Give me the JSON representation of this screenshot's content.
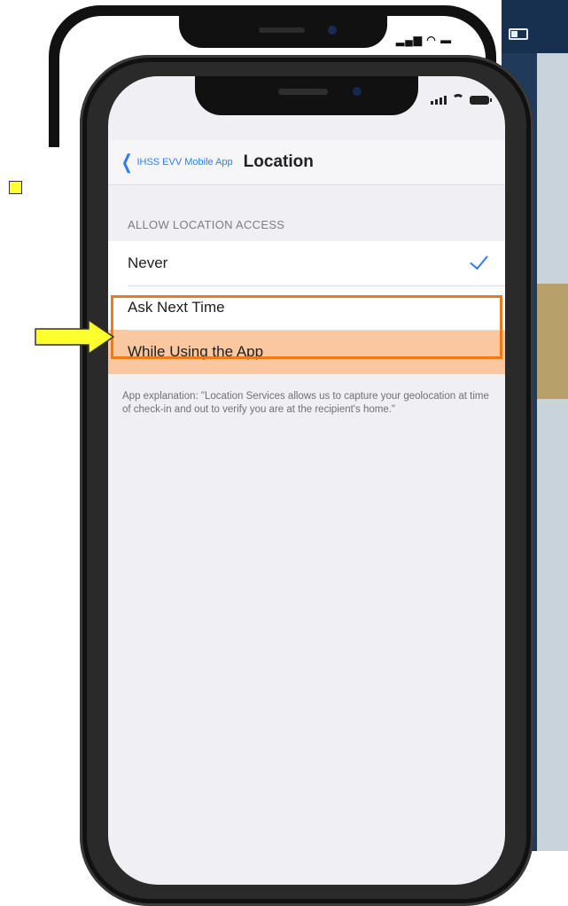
{
  "nav": {
    "back_label": "IHSS EVV Mobile App",
    "title": "Location"
  },
  "section_header": "ALLOW LOCATION ACCESS",
  "options": [
    {
      "label": "Never",
      "checked": true
    },
    {
      "label": "Ask Next Time",
      "checked": false
    },
    {
      "label": "While Using the App",
      "checked": false,
      "highlighted": true
    }
  ],
  "explanation": "App explanation: \"Location Services allows us to capture your geolocation at time of check-in and out to verify you are at the recipient's home.\"",
  "icons": {
    "back": "chevron-left-icon",
    "check": "checkmark-icon",
    "signal": "cellular-signal-icon",
    "wifi": "wifi-icon",
    "battery": "battery-icon",
    "arrow": "right-arrow-icon"
  },
  "colors": {
    "accent": "#2f7df6",
    "highlight_fill": "#f9c8a1",
    "highlight_border": "#f07a18",
    "arrow_fill": "#ffff2e"
  }
}
